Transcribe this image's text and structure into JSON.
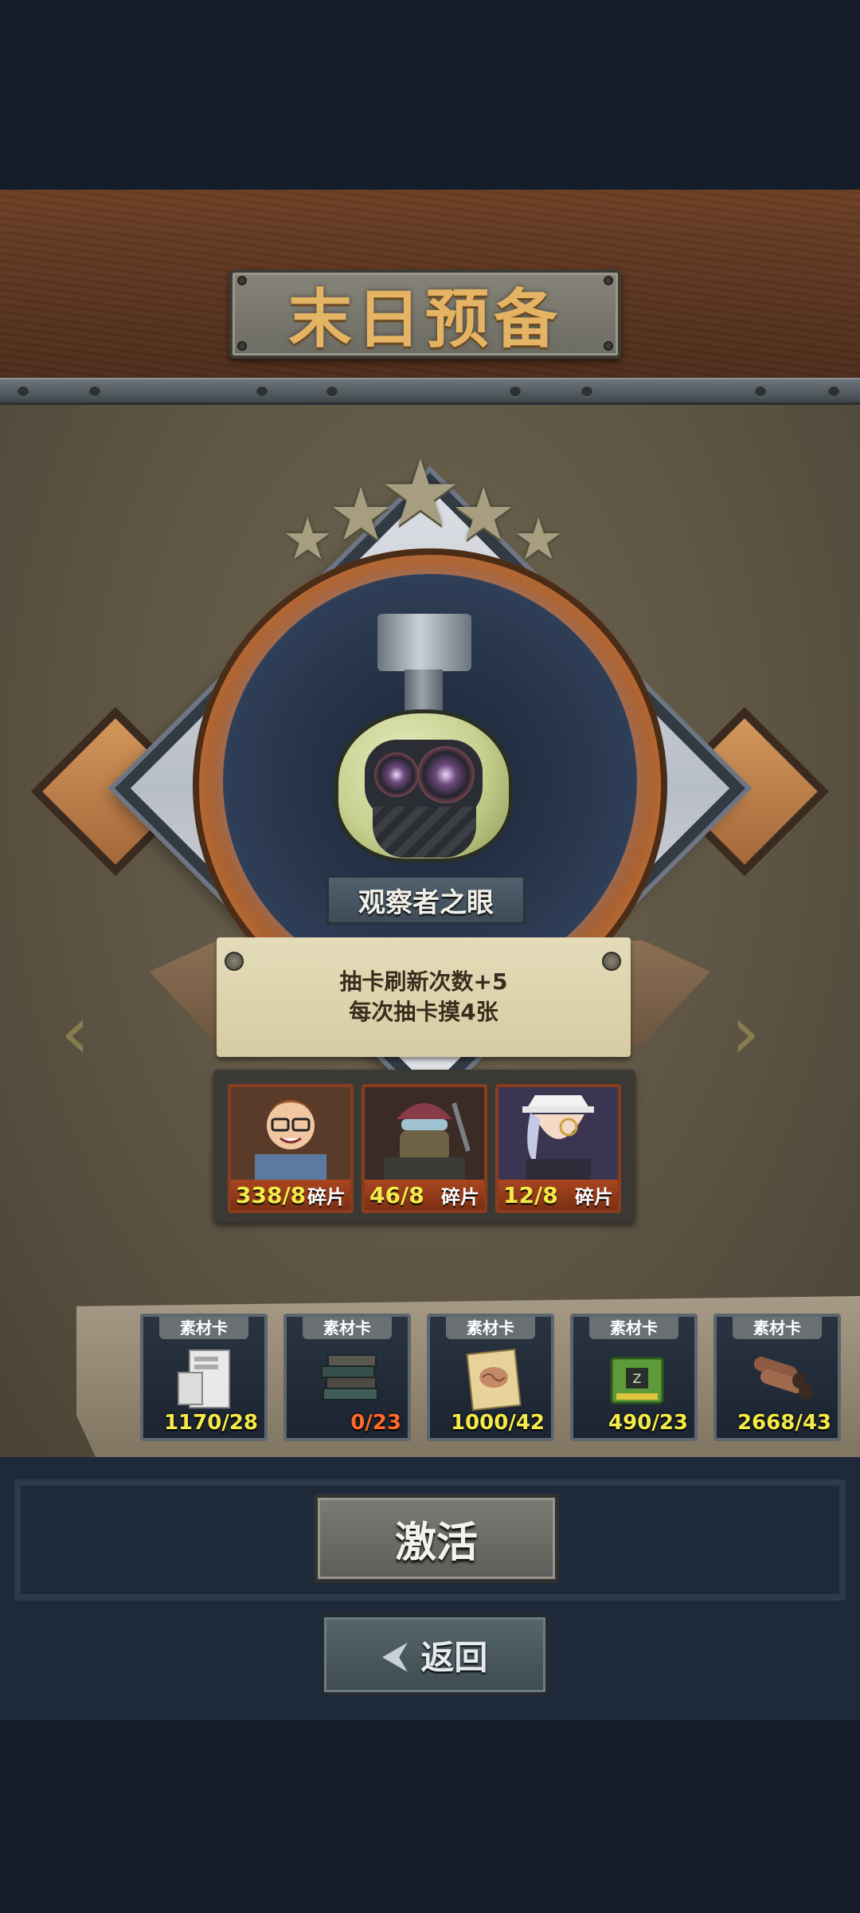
{
  "title": "末日预备",
  "ability": {
    "name": "观察者之眼",
    "stars": 5,
    "description_lines": [
      "抽卡刷新次数+5",
      "每次抽卡摸4张"
    ]
  },
  "navigation": {
    "prev_icon": "chevron-left-icon",
    "next_icon": "chevron-right-icon"
  },
  "fragments": [
    {
      "count": "338/8",
      "label": "碎片",
      "character": "glasses-boy"
    },
    {
      "count": "46/8",
      "label": "碎片",
      "character": "masked-goggles"
    },
    {
      "count": "12/8",
      "label": "碎片",
      "character": "white-hat-monocle"
    }
  ],
  "materials": [
    {
      "tag": "素材卡",
      "count": "1170/28",
      "icon": "computer-case-icon",
      "insufficient": false
    },
    {
      "tag": "素材卡",
      "count": "0/23",
      "icon": "books-icon",
      "insufficient": true
    },
    {
      "tag": "素材卡",
      "count": "1000/42",
      "icon": "brain-paper-icon",
      "insufficient": false
    },
    {
      "tag": "素材卡",
      "count": "490/23",
      "icon": "chip-icon",
      "insufficient": false
    },
    {
      "tag": "素材卡",
      "count": "2668/43",
      "icon": "pipes-icon",
      "insufficient": false
    }
  ],
  "buttons": {
    "activate": "激活",
    "back": "返回"
  },
  "colors": {
    "count_ok": "#f4ea49",
    "count_insufficient": "#ff6a2a",
    "title": "#e4b363"
  }
}
